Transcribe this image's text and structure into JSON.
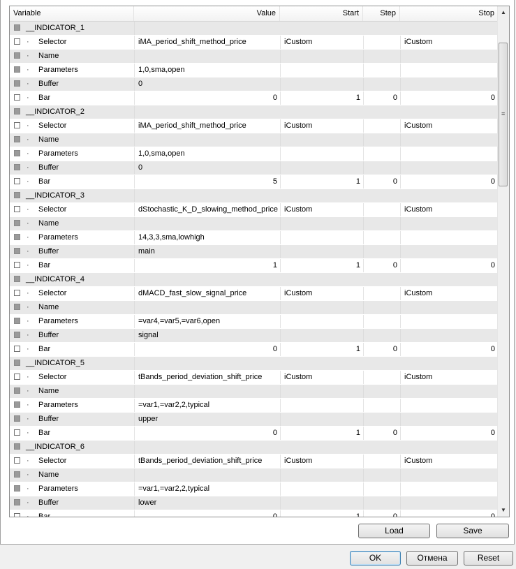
{
  "columns": {
    "variable": "Variable",
    "value": "Value",
    "start": "Start",
    "step": "Step",
    "stop": "Stop"
  },
  "rows": [
    {
      "kind": "group",
      "name": "__INDICATOR_1"
    },
    {
      "kind": "param",
      "name": "Selector",
      "value": "iMA_period_shift_method_price",
      "start": "iCustom",
      "step": "",
      "stop": "iCustom",
      "num": false
    },
    {
      "kind": "param",
      "name": "Name",
      "value": "",
      "start": "",
      "step": "",
      "stop": "",
      "num": false,
      "locked": true
    },
    {
      "kind": "param",
      "name": "Parameters",
      "value": "1,0,sma,open",
      "start": "",
      "step": "",
      "stop": "",
      "num": false,
      "locked": true
    },
    {
      "kind": "param",
      "name": "Buffer",
      "value": "0",
      "start": "",
      "step": "",
      "stop": "",
      "num": false,
      "locked": true
    },
    {
      "kind": "param",
      "name": "Bar",
      "value": "0",
      "start": "1",
      "step": "0",
      "stop": "0",
      "num": true
    },
    {
      "kind": "group",
      "name": "__INDICATOR_2"
    },
    {
      "kind": "param",
      "name": "Selector",
      "value": "iMA_period_shift_method_price",
      "start": "iCustom",
      "step": "",
      "stop": "iCustom",
      "num": false
    },
    {
      "kind": "param",
      "name": "Name",
      "value": "",
      "start": "",
      "step": "",
      "stop": "",
      "num": false,
      "locked": true
    },
    {
      "kind": "param",
      "name": "Parameters",
      "value": "1,0,sma,open",
      "start": "",
      "step": "",
      "stop": "",
      "num": false,
      "locked": true
    },
    {
      "kind": "param",
      "name": "Buffer",
      "value": "0",
      "start": "",
      "step": "",
      "stop": "",
      "num": false,
      "locked": true
    },
    {
      "kind": "param",
      "name": "Bar",
      "value": "5",
      "start": "1",
      "step": "0",
      "stop": "0",
      "num": true
    },
    {
      "kind": "group",
      "name": "__INDICATOR_3"
    },
    {
      "kind": "param",
      "name": "Selector",
      "value": "dStochastic_K_D_slowing_method_price",
      "start": "iCustom",
      "step": "",
      "stop": "iCustom",
      "num": false
    },
    {
      "kind": "param",
      "name": "Name",
      "value": "",
      "start": "",
      "step": "",
      "stop": "",
      "num": false,
      "locked": true
    },
    {
      "kind": "param",
      "name": "Parameters",
      "value": "14,3,3,sma,lowhigh",
      "start": "",
      "step": "",
      "stop": "",
      "num": false,
      "locked": true
    },
    {
      "kind": "param",
      "name": "Buffer",
      "value": "main",
      "start": "",
      "step": "",
      "stop": "",
      "num": false,
      "locked": true
    },
    {
      "kind": "param",
      "name": "Bar",
      "value": "1",
      "start": "1",
      "step": "0",
      "stop": "0",
      "num": true
    },
    {
      "kind": "group",
      "name": "__INDICATOR_4"
    },
    {
      "kind": "param",
      "name": "Selector",
      "value": "dMACD_fast_slow_signal_price",
      "start": "iCustom",
      "step": "",
      "stop": "iCustom",
      "num": false
    },
    {
      "kind": "param",
      "name": "Name",
      "value": "",
      "start": "",
      "step": "",
      "stop": "",
      "num": false,
      "locked": true
    },
    {
      "kind": "param",
      "name": "Parameters",
      "value": "=var4,=var5,=var6,open",
      "start": "",
      "step": "",
      "stop": "",
      "num": false,
      "locked": true
    },
    {
      "kind": "param",
      "name": "Buffer",
      "value": "signal",
      "start": "",
      "step": "",
      "stop": "",
      "num": false,
      "locked": true
    },
    {
      "kind": "param",
      "name": "Bar",
      "value": "0",
      "start": "1",
      "step": "0",
      "stop": "0",
      "num": true
    },
    {
      "kind": "group",
      "name": "__INDICATOR_5"
    },
    {
      "kind": "param",
      "name": "Selector",
      "value": "tBands_period_deviation_shift_price",
      "start": "iCustom",
      "step": "",
      "stop": "iCustom",
      "num": false
    },
    {
      "kind": "param",
      "name": "Name",
      "value": "",
      "start": "",
      "step": "",
      "stop": "",
      "num": false,
      "locked": true
    },
    {
      "kind": "param",
      "name": "Parameters",
      "value": "=var1,=var2,2,typical",
      "start": "",
      "step": "",
      "stop": "",
      "num": false,
      "locked": true
    },
    {
      "kind": "param",
      "name": "Buffer",
      "value": "upper",
      "start": "",
      "step": "",
      "stop": "",
      "num": false,
      "locked": true
    },
    {
      "kind": "param",
      "name": "Bar",
      "value": "0",
      "start": "1",
      "step": "0",
      "stop": "0",
      "num": true
    },
    {
      "kind": "group",
      "name": "__INDICATOR_6"
    },
    {
      "kind": "param",
      "name": "Selector",
      "value": "tBands_period_deviation_shift_price",
      "start": "iCustom",
      "step": "",
      "stop": "iCustom",
      "num": false
    },
    {
      "kind": "param",
      "name": "Name",
      "value": "",
      "start": "",
      "step": "",
      "stop": "",
      "num": false,
      "locked": true
    },
    {
      "kind": "param",
      "name": "Parameters",
      "value": "=var1,=var2,2,typical",
      "start": "",
      "step": "",
      "stop": "",
      "num": false,
      "locked": true
    },
    {
      "kind": "param",
      "name": "Buffer",
      "value": "lower",
      "start": "",
      "step": "",
      "stop": "",
      "num": false,
      "locked": true
    },
    {
      "kind": "param",
      "name": "Bar",
      "value": "0",
      "start": "1",
      "step": "0",
      "stop": "0",
      "num": true
    }
  ],
  "scrollbar": {
    "up_icon": "scroll-up-arrow",
    "down_icon": "scroll-down-arrow",
    "grip_icon": "grip-lines"
  },
  "buttons": {
    "load": "Load",
    "save": "Save",
    "ok": "OK",
    "cancel": "Отмена",
    "reset": "Reset"
  },
  "colors": {
    "odd_row": "#e8e8e8",
    "even_row": "#ffffff",
    "default_button_border": "#3c7fb1"
  }
}
